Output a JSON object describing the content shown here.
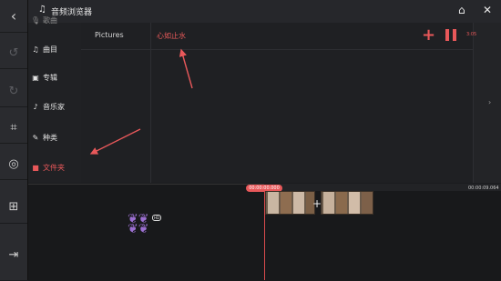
{
  "header": {
    "title": "音频浏览器",
    "music_icon": "music-note-icon",
    "store_icon": "store-icon",
    "close_icon": "close-icon"
  },
  "rail": {
    "back_icon": "back-arrow-icon",
    "undo_icon": "undo-icon",
    "redo_icon": "redo-icon",
    "crop_icon": "crop-frame-icon",
    "target_icon": "target-icon",
    "split_icon": "split-layer-icon",
    "export_icon": "export-icon"
  },
  "sidebar": {
    "items": [
      {
        "label": "歌曲",
        "icon": "microphone-icon"
      },
      {
        "label": "曲目",
        "icon": "music-note-icon"
      },
      {
        "label": "专辑",
        "icon": "album-icon"
      },
      {
        "label": "音乐家",
        "icon": "artist-icon"
      },
      {
        "label": "种类",
        "icon": "guitar-icon"
      },
      {
        "label": "文件夹",
        "icon": "folder-icon",
        "active": true
      }
    ]
  },
  "breadcrumb": {
    "root": "Pictures",
    "current": "心如止水"
  },
  "player": {
    "duration": "3:05",
    "add_icon": "plus-icon",
    "pause_icon": "pause-icon"
  },
  "timeline": {
    "start_time": "00:00:00.000",
    "end_time": "00:00:09.064"
  },
  "colors": {
    "accent": "#e8585a",
    "background": "#1b1c1f",
    "panel": "#1f2023"
  }
}
